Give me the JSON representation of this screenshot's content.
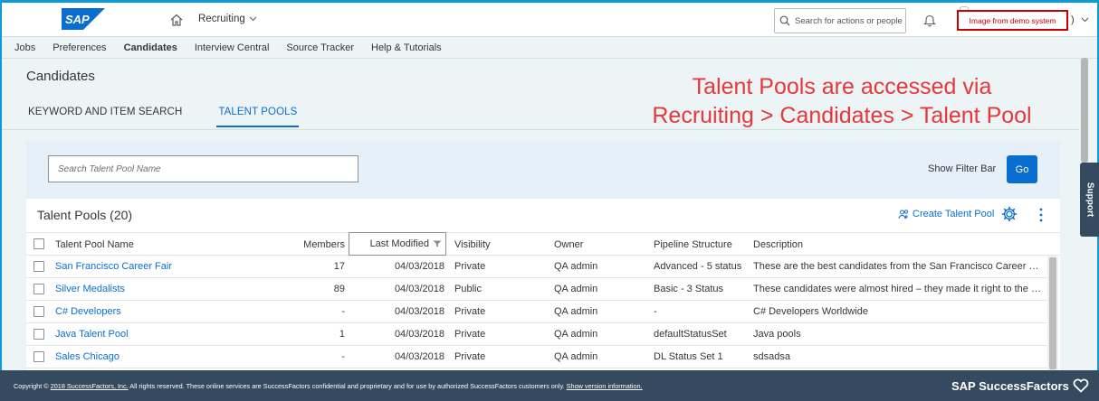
{
  "shell": {
    "logo_text": "SAP",
    "module": "Recruiting",
    "search_placeholder": "Search for actions or people",
    "demo_label": "Image from demo system",
    "user_tail": ")"
  },
  "nav": {
    "items": [
      "Jobs",
      "Preferences",
      "Candidates",
      "Interview Central",
      "Source Tracker",
      "Help & Tutorials"
    ]
  },
  "page": {
    "title": "Candidates",
    "tabs": [
      "KEYWORD AND ITEM SEARCH",
      "TALENT POOLS"
    ]
  },
  "annotation": {
    "line1": "Talent Pools are accessed via",
    "line2": "Recruiting > Candidates > Talent Pool"
  },
  "filter": {
    "placeholder": "Search Talent Pool Name",
    "show_filter_bar": "Show Filter Bar",
    "go": "Go"
  },
  "table": {
    "title": "Talent Pools (20)",
    "create_label": "Create Talent Pool",
    "columns": [
      "Talent Pool Name",
      "Members",
      "Last Modified",
      "Visibility",
      "Owner",
      "Pipeline Structure",
      "Description"
    ],
    "rows": [
      {
        "name": "San Francisco Career Fair",
        "members": "17",
        "modified": "04/03/2018",
        "visibility": "Private",
        "owner": "QA admin",
        "pipeline": "Advanced - 5 status",
        "description": "These are the best candidates from the San Francisco Career Fair..."
      },
      {
        "name": "Silver Medalists",
        "members": "89",
        "modified": "04/03/2018",
        "visibility": "Public",
        "owner": "QA admin",
        "pipeline": "Basic - 3 Status",
        "description": "These candidates were almost hired – they made it right to the en..."
      },
      {
        "name": "C# Developers",
        "members": "-",
        "modified": "04/03/2018",
        "visibility": "Private",
        "owner": "QA admin",
        "pipeline": "-",
        "description": "C# Developers Worldwide"
      },
      {
        "name": "Java Talent Pool",
        "members": "1",
        "modified": "04/03/2018",
        "visibility": "Private",
        "owner": "QA admin",
        "pipeline": "defaultStatusSet",
        "description": "Java pools"
      },
      {
        "name": "Sales Chicago",
        "members": "-",
        "modified": "04/03/2018",
        "visibility": "Private",
        "owner": "QA admin",
        "pipeline": "DL Status Set 1",
        "description": "sdsadsa"
      }
    ]
  },
  "support_label": "Support",
  "footer": {
    "prefix": "Copyright ©",
    "company_link": "2018 SuccessFactors, Inc.",
    "body": " All rights reserved. These online services are SuccessFactors confidential and proprietary and for use by authorized SuccessFactors customers only. ",
    "version_link": "Show version information.",
    "brand": "SAP SuccessFactors"
  },
  "colors": {
    "accent": "#0a6ed1",
    "footer_bg": "#354a5f",
    "annotation": "#e8373a"
  }
}
